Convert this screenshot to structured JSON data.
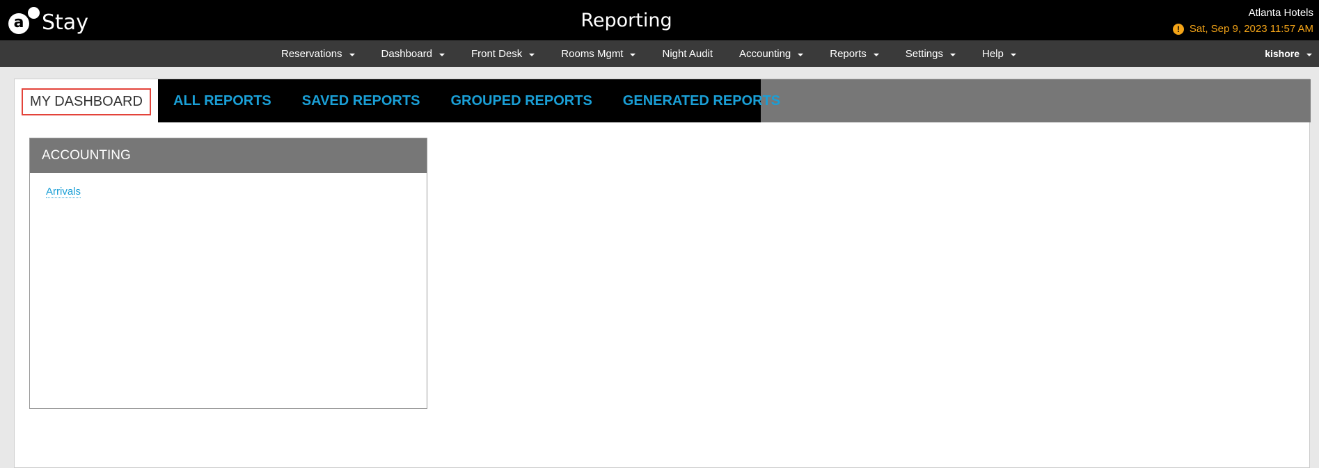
{
  "app": {
    "logo_text": "Stay",
    "logo_letter": "a",
    "page_title": "Reporting"
  },
  "hotel": {
    "name": "Atlanta Hotels",
    "datetime": "Sat, Sep 9, 2023 11:57 AM",
    "alert_icon": "!"
  },
  "nav": {
    "items": [
      {
        "label": "Reservations",
        "dropdown": true
      },
      {
        "label": "Dashboard",
        "dropdown": true
      },
      {
        "label": "Front Desk",
        "dropdown": true
      },
      {
        "label": "Rooms Mgmt",
        "dropdown": true
      },
      {
        "label": "Night Audit",
        "dropdown": false
      },
      {
        "label": "Accounting",
        "dropdown": true
      },
      {
        "label": "Reports",
        "dropdown": true
      },
      {
        "label": "Settings",
        "dropdown": true
      },
      {
        "label": "Help",
        "dropdown": true
      }
    ],
    "user": "kishore"
  },
  "tabs": [
    {
      "label": "MY DASHBOARD",
      "active": true
    },
    {
      "label": "ALL REPORTS",
      "active": false
    },
    {
      "label": "SAVED REPORTS",
      "active": false
    },
    {
      "label": "GROUPED REPORTS",
      "active": false
    },
    {
      "label": "GENERATED REPORTS",
      "active": false
    }
  ],
  "panel": {
    "title": "ACCOUNTING",
    "links": [
      "Arrivals"
    ]
  },
  "colors": {
    "accent_blue": "#1a9fd6",
    "date_orange": "#f4a417",
    "active_tab_border": "#e3433a"
  }
}
